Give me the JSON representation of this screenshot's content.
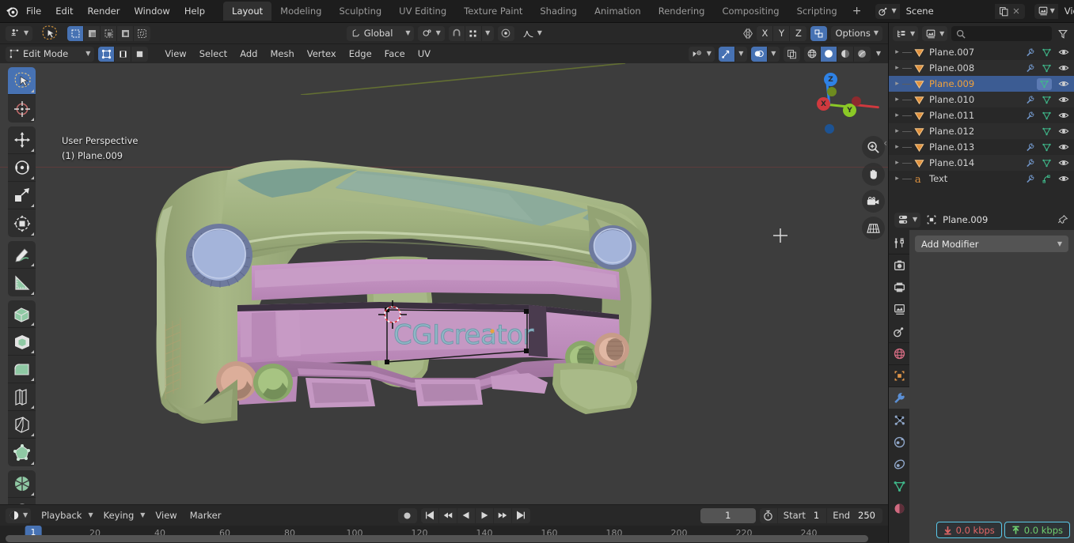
{
  "app": {
    "logo_icon": "blender-logo-icon"
  },
  "topbar": {
    "menus": [
      "File",
      "Edit",
      "Render",
      "Window",
      "Help"
    ],
    "workspace_tabs": [
      {
        "label": "Layout",
        "active": true
      },
      {
        "label": "Modeling",
        "active": false
      },
      {
        "label": "Sculpting",
        "active": false
      },
      {
        "label": "UV Editing",
        "active": false
      },
      {
        "label": "Texture Paint",
        "active": false
      },
      {
        "label": "Shading",
        "active": false
      },
      {
        "label": "Animation",
        "active": false
      },
      {
        "label": "Rendering",
        "active": false
      },
      {
        "label": "Compositing",
        "active": false
      },
      {
        "label": "Scripting",
        "active": false
      }
    ],
    "add_workspace_label": "+",
    "scene": {
      "label": "Scene",
      "browse_icon": "scene-data-icon",
      "new_icon": "copy-icon",
      "remove_icon": "x-icon"
    },
    "view_layer": {
      "label": "View Layer",
      "browse_icon": "view-layer-icon",
      "new_icon": "copy-icon",
      "remove_icon": "x-icon"
    }
  },
  "toolheader": {
    "editor_type_icon": "editor-type-icon",
    "tweak_icon": "tweak-tool-icon",
    "select_modes": [
      {
        "icon": "select-set-icon",
        "active": true
      },
      {
        "icon": "select-extend-icon",
        "active": false
      },
      {
        "icon": "select-subtract-icon",
        "active": false
      },
      {
        "icon": "select-invert-icon",
        "active": false
      },
      {
        "icon": "select-intersect-icon",
        "active": false
      }
    ],
    "transform_orientation": {
      "label": "Global",
      "icon": "orientation-icon"
    },
    "snap": {
      "icon": "snap-magnet-icon",
      "target_icon": "snap-target-icon"
    },
    "proportional": {
      "icon": "proportional-edit-icon",
      "falloff_icon": "falloff-curve-icon"
    },
    "mirror": {
      "icon": "mirror-icon",
      "axes": [
        "X",
        "Y",
        "Z"
      ]
    },
    "auto_merge_icon": "auto-merge-icon",
    "options_label": "Options"
  },
  "viewport_header": {
    "mode": {
      "label": "Edit Mode",
      "icon": "edit-mode-icon"
    },
    "mesh_select_modes": [
      {
        "icon": "vertex-select-icon",
        "active": true
      },
      {
        "icon": "edge-select-icon",
        "active": false
      },
      {
        "icon": "face-select-icon",
        "active": false
      }
    ],
    "menus": [
      "View",
      "Select",
      "Add",
      "Mesh",
      "Vertex",
      "Edge",
      "Face",
      "UV"
    ],
    "visibility_icon": "object-visibility-icon",
    "gizmo_icon": "gizmo-icon",
    "overlays_icon": "overlays-icon",
    "xray_icon": "xray-toggle-icon",
    "shading_modes": [
      {
        "icon": "wireframe-shading-icon",
        "active": false
      },
      {
        "icon": "solid-shading-icon",
        "active": true
      },
      {
        "icon": "material-preview-shading-icon",
        "active": false
      },
      {
        "icon": "rendered-shading-icon",
        "active": false
      }
    ]
  },
  "viewport": {
    "perspective_label": "User Perspective",
    "active_object_label": "(1) Plane.009",
    "gizmo": {
      "axes": [
        {
          "label": "X",
          "color": "#d0393e"
        },
        {
          "label": "Y",
          "color": "#8bc926"
        },
        {
          "label": "Z",
          "color": "#2e82e6"
        }
      ]
    },
    "nav_buttons": [
      {
        "icon": "zoom-icon"
      },
      {
        "icon": "hand-pan-icon"
      },
      {
        "icon": "camera-view-icon"
      },
      {
        "icon": "toggle-ortho-icon"
      }
    ],
    "collapse_icon": "sidebar-collapse-icon",
    "cursor_icon": "crosshair-cursor-icon",
    "object_text": "CGIcreator",
    "colors": {
      "background": "#3d3d3d",
      "body_green": "#9cb07c",
      "accent_purple": "#c292c0",
      "glass_teal": "#7fa58f",
      "headlight_blue": "#9fb0d8",
      "light_pink": "#dbab96",
      "light_green": "#a8c784"
    }
  },
  "toolbar_tools": [
    {
      "icon": "tweak-select-box-icon",
      "name": "tweak",
      "active": true
    },
    {
      "icon": "cursor-3d-icon",
      "name": "cursor-3d",
      "active": false
    },
    {
      "icon": "move-icon",
      "name": "move",
      "active": false
    },
    {
      "icon": "rotate-icon",
      "name": "rotate",
      "active": false
    },
    {
      "icon": "scale-icon",
      "name": "scale",
      "active": false
    },
    {
      "icon": "transform-icon",
      "name": "transform",
      "active": false
    },
    {
      "icon": "annotate-icon",
      "name": "annotate",
      "active": false
    },
    {
      "icon": "measure-icon",
      "name": "measure",
      "active": false
    },
    {
      "icon": "extrude-region-icon",
      "name": "extrude-region",
      "active": false
    },
    {
      "icon": "inset-faces-icon",
      "name": "inset-faces",
      "active": false
    },
    {
      "icon": "bevel-icon",
      "name": "bevel",
      "active": false
    },
    {
      "icon": "loop-cut-icon",
      "name": "loop-cut",
      "active": false
    },
    {
      "icon": "knife-icon",
      "name": "knife",
      "active": false
    },
    {
      "icon": "poly-build-icon",
      "name": "poly-build",
      "active": false
    },
    {
      "icon": "spin-icon",
      "name": "spin",
      "active": false
    },
    {
      "icon": "smooth-icon",
      "name": "smooth",
      "active": false
    }
  ],
  "outliner": {
    "display_mode_icon": "outliner-display-mode-icon",
    "filter_id_icon": "filter-id-icon",
    "search_placeholder": "",
    "search_value": "",
    "search_icon": "search-icon",
    "filter_icon": "funnel-filter-icon",
    "rows": [
      {
        "name": "Plane.007",
        "icon": "mesh-data-icon",
        "selected": false,
        "has_modifier": true,
        "has_mesh": true
      },
      {
        "name": "Plane.008",
        "icon": "mesh-data-icon",
        "selected": false,
        "has_modifier": true,
        "has_mesh": true
      },
      {
        "name": "Plane.009",
        "icon": "mesh-data-icon",
        "selected": true,
        "has_modifier": false,
        "has_mesh": true
      },
      {
        "name": "Plane.010",
        "icon": "mesh-data-icon",
        "selected": false,
        "has_modifier": true,
        "has_mesh": true
      },
      {
        "name": "Plane.011",
        "icon": "mesh-data-icon",
        "selected": false,
        "has_modifier": true,
        "has_mesh": true
      },
      {
        "name": "Plane.012",
        "icon": "mesh-data-icon",
        "selected": false,
        "has_modifier": false,
        "has_mesh": true
      },
      {
        "name": "Plane.013",
        "icon": "mesh-data-icon",
        "selected": false,
        "has_modifier": true,
        "has_mesh": true
      },
      {
        "name": "Plane.014",
        "icon": "mesh-data-icon",
        "selected": false,
        "has_modifier": true,
        "has_mesh": true
      },
      {
        "name": "Text",
        "icon": "font-data-icon",
        "selected": false,
        "has_modifier": true,
        "has_mesh": false
      }
    ]
  },
  "properties": {
    "editor_icon": "properties-editor-icon",
    "breadcrumb_icon": "object-icon",
    "breadcrumb_label": "Plane.009",
    "pin_icon": "pin-icon",
    "add_modifier_label": "Add Modifier",
    "add_modifier_chevron": "chevron-down-icon",
    "tabs": [
      {
        "icon": "tool-tab-icon",
        "name": "tool",
        "active": false
      },
      {
        "icon": "render-tab-icon",
        "name": "render",
        "active": false
      },
      {
        "icon": "output-tab-icon",
        "name": "output",
        "active": false
      },
      {
        "icon": "view-layer-tab-icon",
        "name": "view-layer",
        "active": false
      },
      {
        "icon": "scene-tab-icon",
        "name": "scene",
        "active": false
      },
      {
        "icon": "world-tab-icon",
        "name": "world",
        "active": false
      },
      {
        "icon": "object-tab-icon",
        "name": "object",
        "active": false
      },
      {
        "icon": "modifier-wrench-tab-icon",
        "name": "modifier",
        "active": true
      },
      {
        "icon": "particles-tab-icon",
        "name": "particles",
        "active": false
      },
      {
        "icon": "physics-tab-icon",
        "name": "physics",
        "active": false
      },
      {
        "icon": "constraints-tab-icon",
        "name": "constraints",
        "active": false
      },
      {
        "icon": "data-tab-icon",
        "name": "object-data",
        "active": false
      },
      {
        "icon": "material-tab-icon",
        "name": "material",
        "active": false
      }
    ]
  },
  "network_status": {
    "download_icon": "download-arrow-icon",
    "download_value": "0.0 kbps",
    "upload_icon": "upload-arrow-icon",
    "upload_value": "0.0 kbps"
  },
  "timeline": {
    "editor_icon": "timeline-editor-icon",
    "menus": [
      "Playback",
      "Keying",
      "View",
      "Marker"
    ],
    "record_icon": "record-icon",
    "transport": [
      {
        "icon": "jump-start-icon"
      },
      {
        "icon": "prev-keyframe-icon"
      },
      {
        "icon": "play-reverse-icon"
      },
      {
        "icon": "play-icon"
      },
      {
        "icon": "next-keyframe-icon"
      },
      {
        "icon": "jump-end-icon"
      }
    ],
    "current_frame": "1",
    "use_preview_range_icon": "stopwatch-icon",
    "start_label": "Start",
    "start_value": "1",
    "end_label": "End",
    "end_value": "250",
    "playhead_label": "1",
    "ruler_ticks": [
      "20",
      "40",
      "60",
      "80",
      "100",
      "120",
      "140",
      "160",
      "180",
      "200",
      "220",
      "240"
    ]
  }
}
